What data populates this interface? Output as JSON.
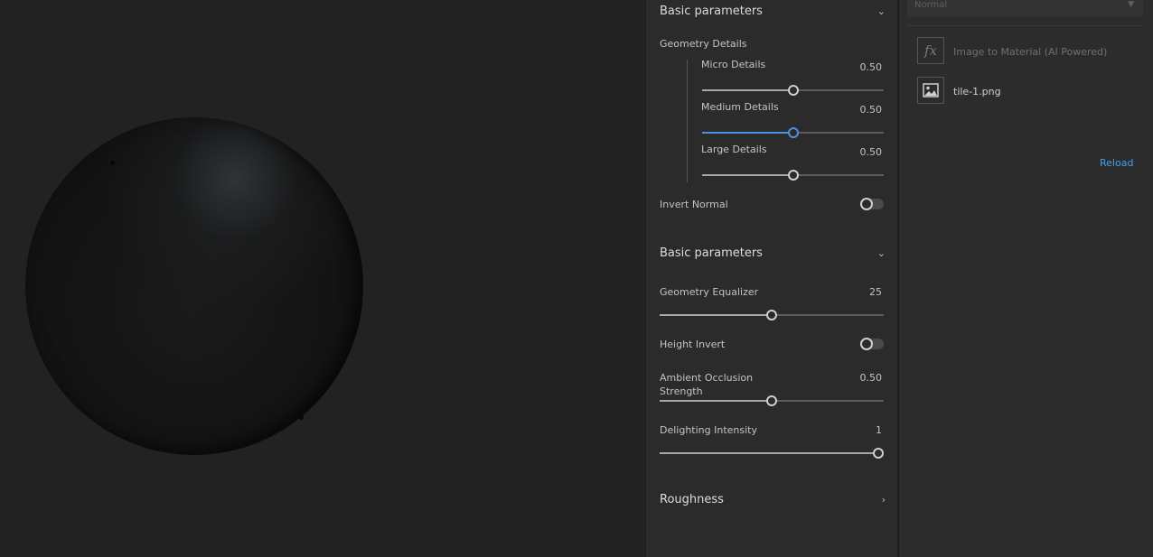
{
  "viewport": {},
  "panel": {
    "section1": {
      "title": "Basic parameters",
      "group_label": "Geometry Details",
      "sliders": [
        {
          "label": "Micro Details",
          "value": "0.50",
          "level": 0.5
        },
        {
          "label": "Medium Details",
          "value": "0.50",
          "level": 0.5
        },
        {
          "label": "Large Details",
          "value": "0.50",
          "level": 0.5
        }
      ],
      "invert_normal_label": "Invert Normal"
    },
    "section2": {
      "title": "Basic parameters",
      "geometry_equalizer": {
        "label": "Geometry Equalizer",
        "value": "25",
        "level": 0.5
      },
      "height_invert_label": "Height Invert",
      "ao_strength": {
        "label_line1": "Ambient Occlusion",
        "label_line2": "Strength",
        "value": "0.50",
        "level": 0.5
      },
      "delighting": {
        "label": "Delighting Intensity",
        "value": "1",
        "level": 1.0
      }
    },
    "section3": {
      "title": "Roughness"
    }
  },
  "sources": {
    "blend_mode": "Normal",
    "items": [
      {
        "icon": "fx-icon",
        "label": "Image to Material (AI Powered)"
      },
      {
        "icon": "image-icon",
        "label": "tile-1.png"
      }
    ],
    "reload_label": "Reload"
  },
  "colors": {
    "accent": "#4a90e2",
    "link": "#4a9cf0"
  }
}
